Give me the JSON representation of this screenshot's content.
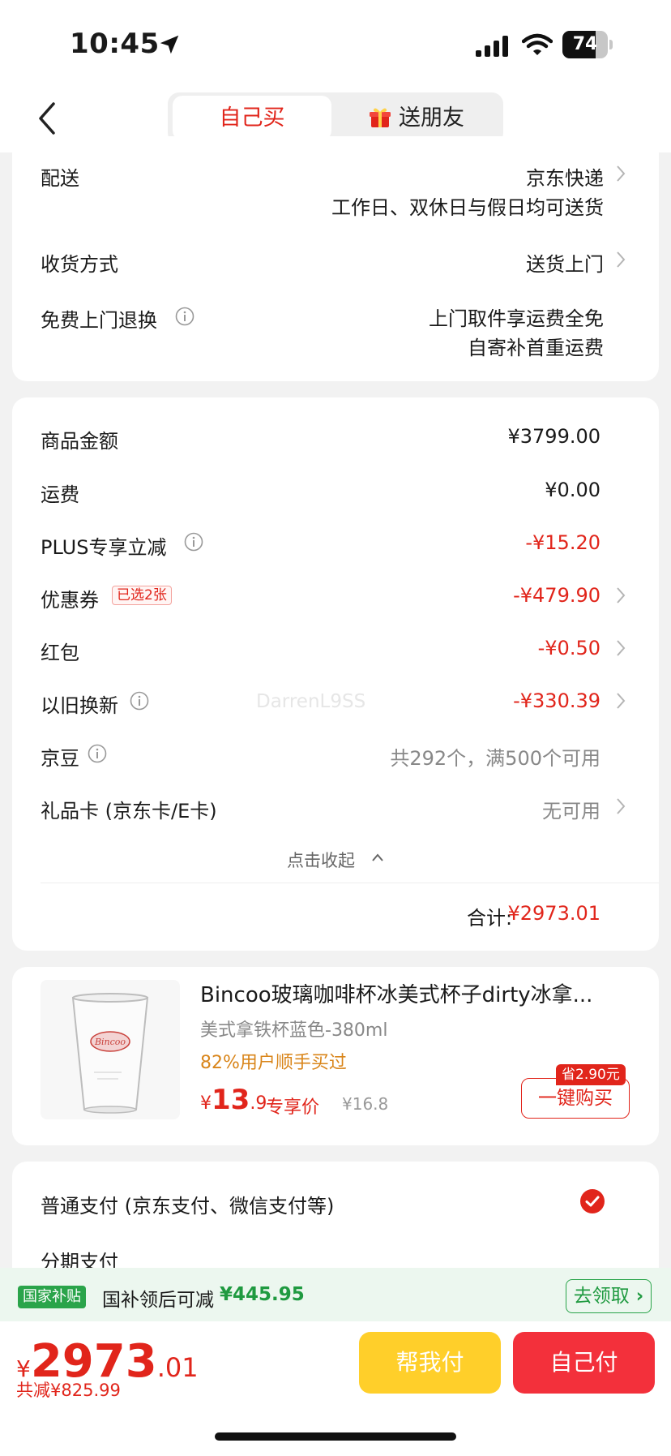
{
  "status_bar": {
    "time": "10:45",
    "battery": "74",
    "battery_level": 0.74
  },
  "nav": {
    "tab_self": "自己买",
    "tab_friend": "送朋友"
  },
  "delivery": {
    "shipping_label": "配送",
    "shipping_value1": "京东快递",
    "shipping_value2": "工作日、双休日与假日均可送货",
    "method_label": "收货方式",
    "method_value": "送货上门",
    "return_label": "免费上门退换",
    "return_value1": "上门取件享运费全免",
    "return_value2": "自寄补首重运费"
  },
  "pricing": {
    "goods_label": "商品金额",
    "goods_value": "¥3799.00",
    "freight_label": "运费",
    "freight_value": "¥0.00",
    "plus_label": "PLUS专享立减",
    "plus_value": "-¥15.20",
    "coupon_label": "优惠券",
    "coupon_badge": "已选2张",
    "coupon_value": "-¥479.90",
    "redpacket_label": "红包",
    "redpacket_value": "-¥0.50",
    "tradein_label": "以旧换新",
    "tradein_value": "-¥330.39",
    "jingdou_label": "京豆",
    "jingdou_value": "共292个，满500个可用",
    "giftcard_label": "礼品卡 (京东卡/E卡)",
    "giftcard_value": "无可用",
    "collapse_label": "点击收起",
    "total_label": "合计:",
    "total_value": "¥2973.01",
    "watermark": "DarrenL9SS"
  },
  "product": {
    "title": "Bincoo玻璃咖啡杯冰美式杯子dirty冰拿...",
    "spec": "美式拿铁杯蓝色-380ml",
    "repurchase": "82%用户顺手买过",
    "currency": "¥",
    "price_int": "13",
    "price_dec": ".9",
    "price_tag": "专享价",
    "orig_price": "¥16.8",
    "save_badge": "省2.90元",
    "buy_button": "一键购买",
    "cup_logo": "Bincoo"
  },
  "payment": {
    "normal_label": "普通支付 (京东支付、微信支付等)",
    "installment_label": "分期支付"
  },
  "subsidy": {
    "badge": "国家补贴",
    "text": "国补领后可减",
    "amount": "¥445.95",
    "button": "去领取"
  },
  "bottom": {
    "currency": "¥",
    "total_int": "2973",
    "total_dec": ".01",
    "saved": "共减¥825.99",
    "help_pay": "帮我付",
    "self_pay": "自己付"
  },
  "colors": {
    "accent_red": "#e1251b",
    "subsidy_green": "#2aa44a",
    "help_yellow": "#ffcf2a",
    "pay_red": "#f3303b"
  }
}
